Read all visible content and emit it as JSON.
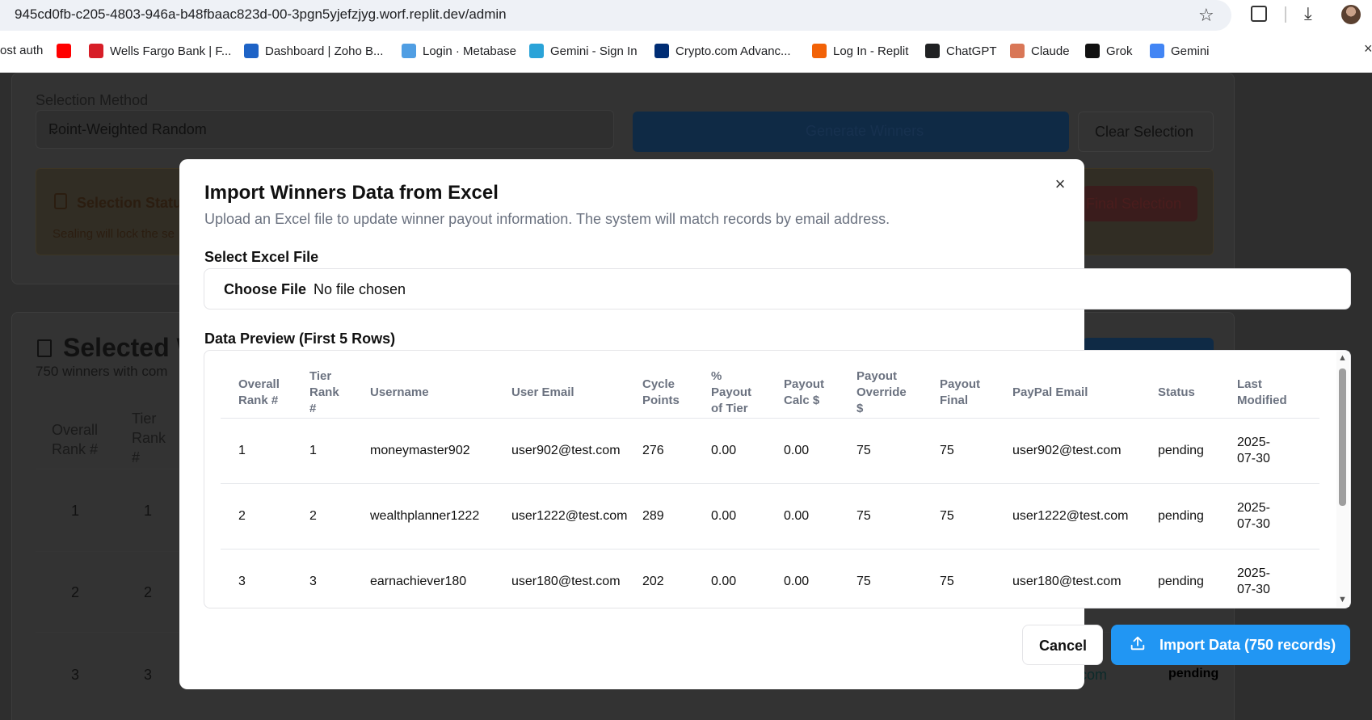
{
  "browser": {
    "url": "945cd0fb-c205-4803-946a-b48fbaac823d-00-3pgn5yjefzjyg.worf.replit.dev/admin",
    "bookmarks": [
      {
        "label": "ost auth",
        "icon": "none",
        "color": "#ffffff"
      },
      {
        "label": "",
        "icon": "youtube-icon",
        "color": "#ff0000"
      },
      {
        "label": "Wells Fargo Bank | F...",
        "icon": "wellsfargo-icon",
        "color": "#d71e28"
      },
      {
        "label": "Dashboard | Zoho B...",
        "icon": "zoho-icon",
        "color": "#1e63c6"
      },
      {
        "label": "Login · Metabase",
        "icon": "metabase-icon",
        "color": "#509ee3"
      },
      {
        "label": "Gemini - Sign In",
        "icon": "gemini-link-icon",
        "color": "#2aa3d8"
      },
      {
        "label": "Crypto.com Advanc...",
        "icon": "crypto-icon",
        "color": "#002d74"
      },
      {
        "label": "Log In - Replit",
        "icon": "replit-icon",
        "color": "#f26207"
      },
      {
        "label": "ChatGPT",
        "icon": "chatgpt-icon",
        "color": "#202123"
      },
      {
        "label": "Claude",
        "icon": "claude-icon",
        "color": "#d97757"
      },
      {
        "label": "Grok",
        "icon": "grok-icon",
        "color": "#111111"
      },
      {
        "label": "Gemini",
        "icon": "gemini-icon",
        "color": "#4285f4"
      }
    ],
    "bookmarks_close": "×"
  },
  "background": {
    "selection_method_label": "Selection Method",
    "selection_method_value": "Point-Weighted Random",
    "generate_label": "Generate Winners",
    "clear_label": "Clear Selection",
    "status_title": "Selection Statu",
    "status_sub": "Sealing will lock the se",
    "final_label": "Final Selection",
    "selected_title": "Selected W",
    "selected_sub": "750 winners with com",
    "headers": [
      "Overall Rank #",
      "Tier Rank #"
    ],
    "rows": [
      [
        "1",
        "1"
      ],
      [
        "2",
        "2"
      ],
      [
        "3",
        "3"
      ]
    ],
    "email_fragment": "com",
    "status_fragment": "pending"
  },
  "modal": {
    "title": "Import Winners Data from Excel",
    "description": "Upload an Excel file to update winner payout information. The system will match records by email address.",
    "file_label": "Select Excel File",
    "file_button": "Choose File",
    "file_status": "No file chosen",
    "preview_label": "Data Preview (First 5 Rows)",
    "columns": [
      {
        "lines": [
          "Overall",
          "Rank #"
        ]
      },
      {
        "lines": [
          "Tier",
          "Rank",
          "#"
        ]
      },
      {
        "lines": [
          "Username"
        ]
      },
      {
        "lines": [
          "User Email"
        ]
      },
      {
        "lines": [
          "Cycle",
          "Points"
        ]
      },
      {
        "lines": [
          "%",
          "Payout",
          "of Tier"
        ]
      },
      {
        "lines": [
          "Payout",
          "Calc $"
        ]
      },
      {
        "lines": [
          "Payout",
          "Override",
          "$"
        ]
      },
      {
        "lines": [
          "Payout",
          "Final"
        ]
      },
      {
        "lines": [
          "PayPal Email"
        ]
      },
      {
        "lines": [
          "Status"
        ]
      },
      {
        "lines": [
          "Last",
          "Modified"
        ]
      }
    ],
    "rows": [
      [
        "1",
        "1",
        "moneymaster902",
        "user902@test.com",
        "276",
        "0.00",
        "0.00",
        "75",
        "75",
        "user902@test.com",
        "pending",
        "2025-|07-30"
      ],
      [
        "2",
        "2",
        "wealthplanner1222",
        "user1222@test.com",
        "289",
        "0.00",
        "0.00",
        "75",
        "75",
        "user1222@test.com",
        "pending",
        "2025-|07-30"
      ],
      [
        "3",
        "3",
        "earnachiever180",
        "user180@test.com",
        "202",
        "0.00",
        "0.00",
        "75",
        "75",
        "user180@test.com",
        "pending",
        "2025-|07-30"
      ]
    ],
    "cancel_label": "Cancel",
    "import_label": "Import Data (750 records)",
    "close_symbol": "×",
    "accent_color": "#2196f3"
  }
}
